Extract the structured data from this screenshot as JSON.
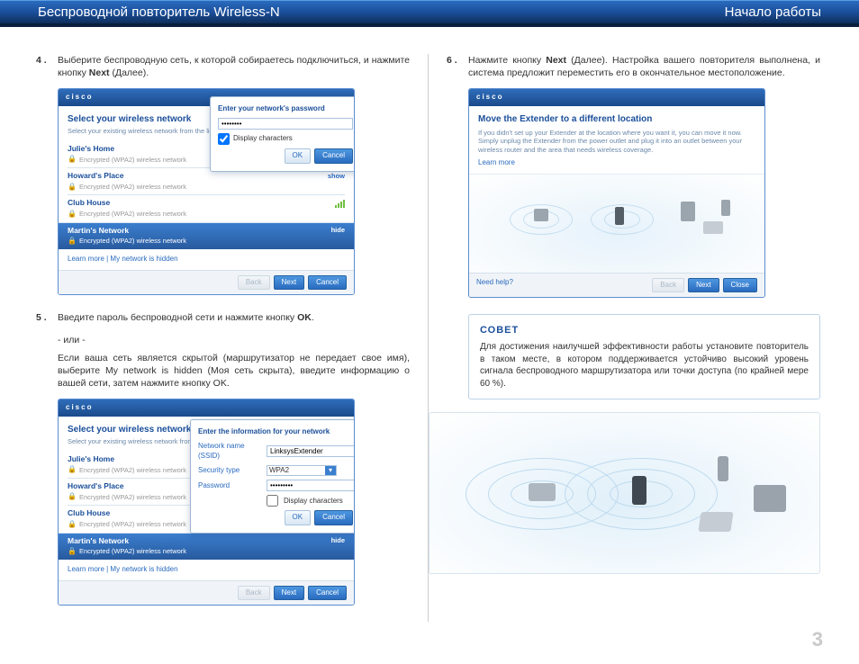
{
  "header": {
    "left": "Беспроводной повторитель Wireless-N",
    "right": "Начало работы"
  },
  "page_number": "3",
  "steps": {
    "s4": {
      "num": "4 .",
      "text_a": "Выберите беспроводную сеть, к которой собираетесь подключиться, и нажмите кнопку ",
      "bold": "Next",
      "text_b": " (Далее)."
    },
    "s5": {
      "num": "5 .",
      "line1_a": "Введите пароль беспроводной сети и нажмите кнопку ",
      "line1_b": "OK",
      "line1_c": ".",
      "or": "- или -",
      "p2": "Если ваша сеть является скрытой (маршрутизатор не передает свое имя), выберите My network is hidden (Моя сеть скрыта), введите информацию о вашей сети, затем нажмите кнопку OK."
    },
    "s6": {
      "num": "6 .",
      "text_a": "Нажмите кнопку ",
      "bold": "Next",
      "text_b": " (Далее). Настройка вашего повторителя выполнена, и система предложит переместить его в окончательное местоположение."
    }
  },
  "tip": {
    "title": "Совет",
    "body": "Для достижения наилучшей эффективности работы установите повторитель в таком месте, в котором поддерживается устойчиво высокий уровень сигнала беспроводного маршрутизатора или точки доступа (по крайней мере 60 %)."
  },
  "dlg": {
    "brand": "cisco",
    "select_title": "Select your wireless network",
    "select_sub": "Select your existing wireless network from the list below.",
    "networks": [
      {
        "name": "Julie's Home",
        "sec": "Encrypted (WPA2) wireless network"
      },
      {
        "name": "Howard's Place",
        "sec": "Encrypted (WPA2) wireless network"
      },
      {
        "name": "Club House",
        "sec": "Encrypted (WPA2) wireless network"
      },
      {
        "name": "Martin's Network",
        "sec": "Encrypted (WPA2) wireless network"
      }
    ],
    "show_label": "show",
    "hide_label": "hide",
    "links": "Learn more   |   My network is hidden",
    "btn_back": "Back",
    "btn_next": "Next",
    "btn_cancel": "Cancel",
    "pw_modal_title": "Enter your network's password",
    "pw_value": "••••••••",
    "display_chars": "Display characters",
    "btn_ok": "OK",
    "info_title": "Enter the information for your network",
    "lbl_ssid": "Network name (SSID)",
    "lbl_sectype": "Security type",
    "lbl_password": "Password",
    "val_ssid": "LinksysExtender",
    "val_sectype": "WPA2",
    "val_password": "•••••••••",
    "move_title": "Move the Extender to a different location",
    "move_body": "If you didn't set up your Extender at the location where you want it, you can move it now. Simply unplug the Extender from the power outlet and plug it into an outlet between your wireless router and the area that needs wireless coverage.",
    "learn_more": "Learn more",
    "need_help": "Need help?",
    "btn_close": "Close"
  }
}
